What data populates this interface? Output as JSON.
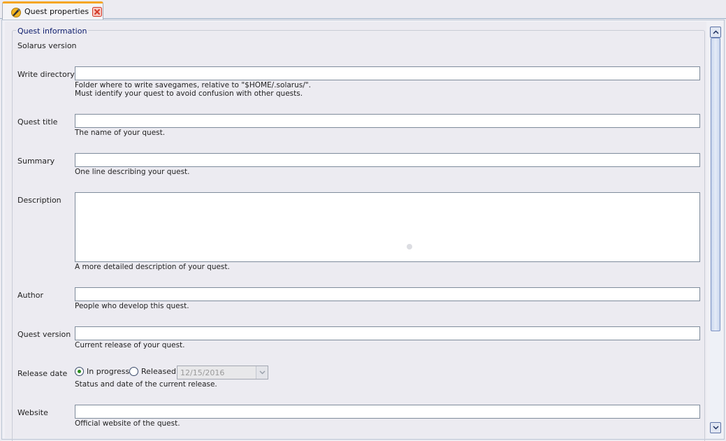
{
  "tab": {
    "title": "Quest properties",
    "accent": "#f5a623",
    "close_color": "#e04040"
  },
  "group": {
    "title": "Quest information"
  },
  "fields": {
    "solarus_version": {
      "label": "Solarus version"
    },
    "write_directory": {
      "label": "Write directory",
      "value": "",
      "hint": "Folder where to write savegames, relative to \"$HOME/.solarus/\".\nMust identify your quest to avoid confusion with other quests."
    },
    "quest_title": {
      "label": "Quest title",
      "value": "",
      "hint": "The name of your quest."
    },
    "summary": {
      "label": "Summary",
      "value": "",
      "hint": "One line describing your quest."
    },
    "description": {
      "label": "Description",
      "value": "",
      "hint": "A more detailed description of your quest."
    },
    "author": {
      "label": "Author",
      "value": "",
      "hint": "People who develop this quest."
    },
    "quest_version": {
      "label": "Quest version",
      "value": "",
      "hint": "Current release of your quest."
    },
    "release_date": {
      "label": "Release date",
      "option_in_progress": "In progress",
      "option_released": "Released",
      "selected": "In progress",
      "date": "12/15/2016",
      "hint": "Status and date of the current release."
    },
    "website": {
      "label": "Website",
      "value": "",
      "hint": "Official website of the quest."
    }
  },
  "scrollbar": {
    "icons": {
      "up": "chevron-up-icon",
      "down": "chevron-down-icon"
    }
  }
}
